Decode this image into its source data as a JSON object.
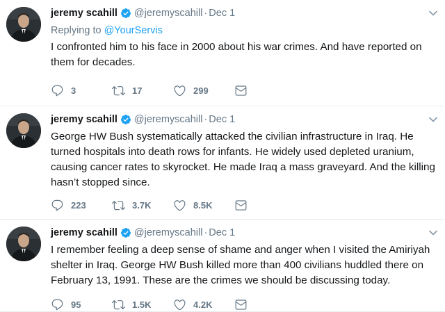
{
  "colors": {
    "link": "#1da1f2",
    "verified": "#1da1f2",
    "muted": "#657786",
    "text": "#14171a"
  },
  "tweets": [
    {
      "name": "jeremy scahill",
      "handle": "@jeremyscahill",
      "dot": "·",
      "date": "Dec 1",
      "replying_label": "Replying to ",
      "replying_to": "@YourServis",
      "text": "I confronted him to his face in 2000 about his war crimes. And have reported on them for decades.",
      "replies": "3",
      "retweets": "17",
      "likes": "299"
    },
    {
      "name": "jeremy scahill",
      "handle": "@jeremyscahill",
      "dot": "·",
      "date": "Dec 1",
      "text": "George HW Bush systematically attacked the civilian infrastructure in Iraq. He turned hospitals into death rows for infants. He widely used depleted uranium, causing cancer rates to skyrocket. He made Iraq a mass graveyard. And the killing hasn’t stopped since.",
      "replies": "223",
      "retweets": "3.7K",
      "likes": "8.5K"
    },
    {
      "name": "jeremy scahill",
      "handle": "@jeremyscahill",
      "dot": "·",
      "date": "Dec 1",
      "text": "I remember feeling a deep sense of shame and anger when I visited the Amiriyah shelter in Iraq. George HW Bush killed more than 400 civilians huddled there on February 13, 1991. These are the crimes we should be discussing today.",
      "replies": "95",
      "retweets": "1.5K",
      "likes": "4.2K"
    }
  ]
}
